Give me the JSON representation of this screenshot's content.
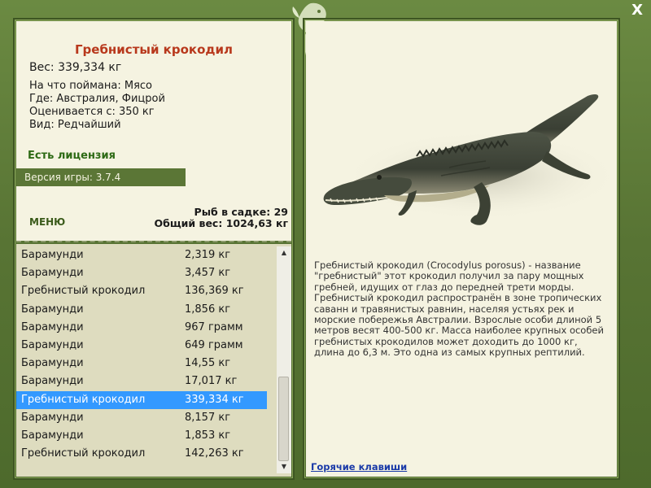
{
  "fish": {
    "title": "Гребнистый крокодил",
    "weight": "Вес: 339,334 кг",
    "bait": "На что поймана: Мясо",
    "location": "Где: Австралия, Фицрой",
    "value": "Оценивается с: 350 кг",
    "rarity": "Вид: Редчайший"
  },
  "license": "Есть лицензия",
  "version": "Версия игры: 3.7.4",
  "menu_label": "МЕНЮ",
  "stats": {
    "in_cage": "Рыб в садке: 29",
    "total_weight": "Общий вес: 1024,63 кг"
  },
  "catch_list": [
    {
      "name": "Барамунди",
      "weight": "2,319 кг"
    },
    {
      "name": "Барамунди",
      "weight": "3,457 кг"
    },
    {
      "name": "Гребнистый крокодил",
      "weight": "136,369 кг"
    },
    {
      "name": "Барамунди",
      "weight": "1,856 кг"
    },
    {
      "name": "Барамунди",
      "weight": "967 грамм"
    },
    {
      "name": "Барамунди",
      "weight": "649 грамм"
    },
    {
      "name": "Барамунди",
      "weight": "14,55 кг"
    },
    {
      "name": "Барамунди",
      "weight": "17,017 кг"
    },
    {
      "name": "Гребнистый крокодил",
      "weight": "339,334 кг"
    },
    {
      "name": "Барамунди",
      "weight": "8,157 кг"
    },
    {
      "name": "Барамунди",
      "weight": "1,853 кг"
    },
    {
      "name": "Гребнистый крокодил",
      "weight": "142,263 кг"
    }
  ],
  "selected_index": 8,
  "description": "Гребнистый крокодил (Crocodylus porosus) - название \"гребнистый\" этот крокодил получил за пару мощных гребней, идущих от глаз до передней трети морды. Гребнистый крокодил распространён в зоне тропических саванн и травянистых равнин, населяя устьях рек и морские побережья Австралии. Взрослые особи длиной 5 метров весят 400-500 кг. Масса наиболее крупных особей гребнистых крокодилов может доходить до 1000 кг, длина до 6,3 м. Это одна из самых крупных рептилий.",
  "hotkeys_label": "Горячие клавиши",
  "close_label": "X",
  "icons": {
    "logo": "fish-logo-icon",
    "close": "close-icon",
    "scroll_up": "scroll-up-icon",
    "scroll_down": "scroll-down-icon"
  },
  "colors": {
    "frame": "#5b7636",
    "panel_bg": "#f5f3e1",
    "list_bg": "#dedcbf",
    "title": "#b8381c",
    "license": "#2d6a14",
    "selection": "#3399ff",
    "link": "#1a3aa8"
  }
}
